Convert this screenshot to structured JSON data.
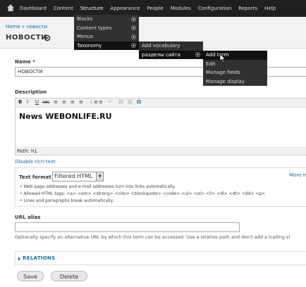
{
  "toolbar": {
    "items": [
      "Dashboard",
      "Content",
      "Structure",
      "Appearance",
      "People",
      "Modules",
      "Configuration",
      "Reports",
      "Help"
    ]
  },
  "breadcrumb": {
    "home": "Home",
    "sep": "»",
    "current": "новости"
  },
  "page_title": "НОВОСТИ",
  "menus": {
    "structure": [
      "Blocks",
      "Content types",
      "Menus",
      "Taxonomy"
    ],
    "taxonomy": [
      "Add vocabulary",
      "разделы сайта"
    ],
    "vocabulary": [
      "Add term",
      "Edit",
      "Manage fields",
      "Manage display"
    ]
  },
  "form": {
    "name_label": "Name",
    "required_mark": "*",
    "name_value": "НОВОСТИ",
    "description_label": "Description",
    "editor_toolbar": [
      "B",
      "I",
      "U",
      "ABC",
      "≡",
      "≡",
      "≡",
      "≡",
      "⋮≡",
      "≡",
      "↶",
      "⛓",
      "⛓",
      "Ω"
    ],
    "editor_content": "News WEBONLIFE.RU",
    "editor_path": "Path: h1",
    "disable_rich_text": "Disable rich-text",
    "text_format_label": "Text format",
    "text_format_value": "Filtered HTML",
    "more_info": "More in",
    "format_tips": [
      "Web page addresses and e-mail addresses turn into links automatically.",
      "Allowed HTML tags: <a> <em> <strong> <cite> <blockquote> <code> <ul> <ol> <li> <dl> <dt> <dd> <p>",
      "Lines and paragraphs break automatically."
    ],
    "url_alias_label": "URL alias",
    "url_alias_value": "",
    "url_alias_desc": "Optionally specify an alternative URL by which this term can be accessed. Use a relative path and don't add a trailing sl",
    "relations_label": "RELATIONS",
    "save_label": "Save",
    "delete_label": "Delete"
  },
  "colors": {
    "toolbar": "#202020",
    "link": "#0074bd",
    "menu": "#303030"
  }
}
